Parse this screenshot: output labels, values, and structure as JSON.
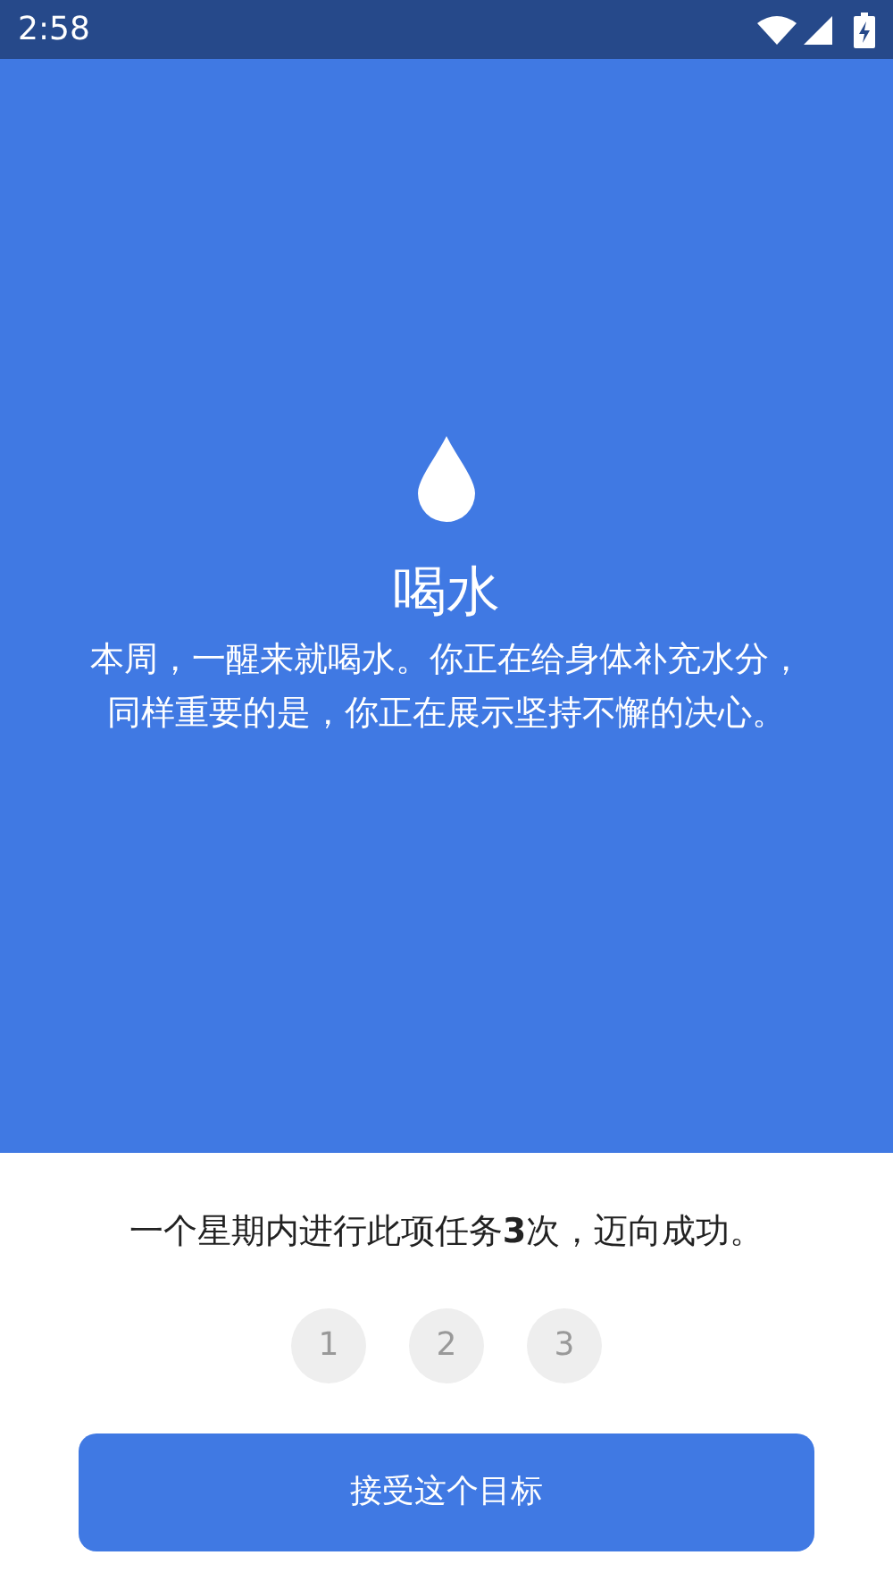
{
  "status_bar": {
    "time": "2:58"
  },
  "habit": {
    "title": "喝水",
    "description": "本周，一醒来就喝水。你正在给身体补充水分，同样重要的是，你正在展示坚持不懈的决心。"
  },
  "goal": {
    "text": "一个星期内进行此项任务**3**次，迈向成功。",
    "steps": [
      {
        "label": "1",
        "done": false
      },
      {
        "label": "2",
        "done": false
      },
      {
        "label": "3",
        "done": false
      }
    ]
  },
  "button": {
    "label": "接受这个目标"
  }
}
